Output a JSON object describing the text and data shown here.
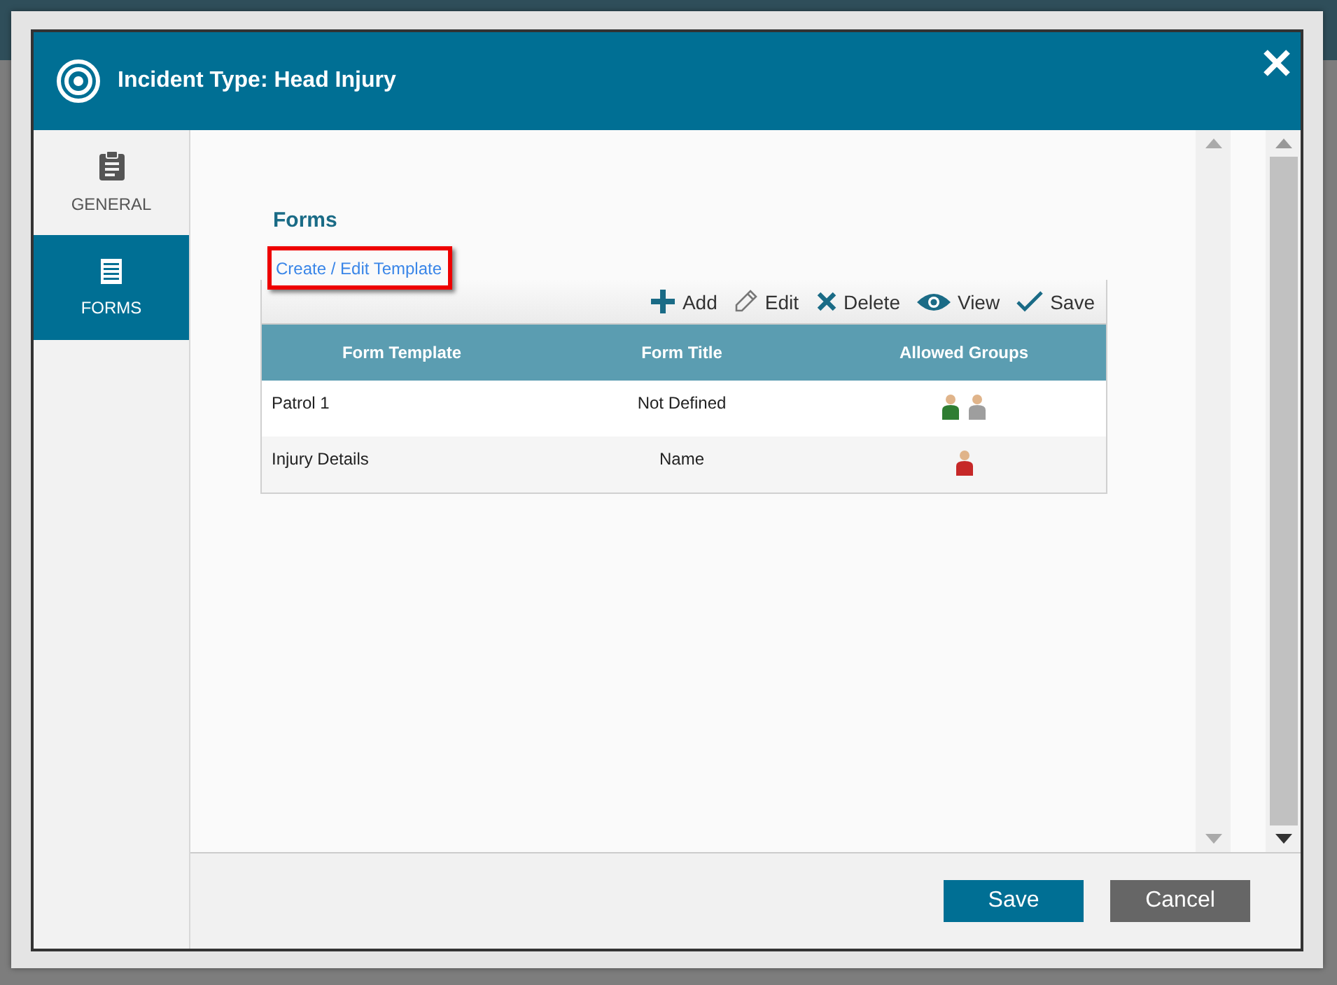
{
  "dialog": {
    "title": "Incident Type: Head Injury"
  },
  "sidebar": {
    "items": [
      {
        "label": "GENERAL",
        "kind": "clipboard",
        "selected": false
      },
      {
        "label": "FORMS",
        "kind": "list",
        "selected": true
      }
    ]
  },
  "section": {
    "title": "Forms",
    "link": "Create / Edit Template"
  },
  "toolbar": [
    {
      "label": "Add",
      "kind": "add"
    },
    {
      "label": "Edit",
      "kind": "edit"
    },
    {
      "label": "Delete",
      "kind": "delete"
    },
    {
      "label": "View",
      "kind": "view"
    },
    {
      "label": "Save",
      "kind": "save"
    }
  ],
  "table": {
    "columns": [
      "Form Template",
      "Form Title",
      "Allowed Groups"
    ],
    "rows": [
      {
        "template": "Patrol 1",
        "title": "Not Defined",
        "groups": [
          {
            "color": "#2e7d32"
          },
          {
            "color": "#9e9e9e"
          }
        ]
      },
      {
        "template": "Injury Details",
        "title": "Name",
        "groups": [
          {
            "color": "#c62828"
          }
        ]
      }
    ]
  },
  "footer": {
    "buttons": [
      {
        "label": "Save",
        "kind": "primary"
      },
      {
        "label": "Cancel",
        "kind": "secondary"
      }
    ]
  }
}
